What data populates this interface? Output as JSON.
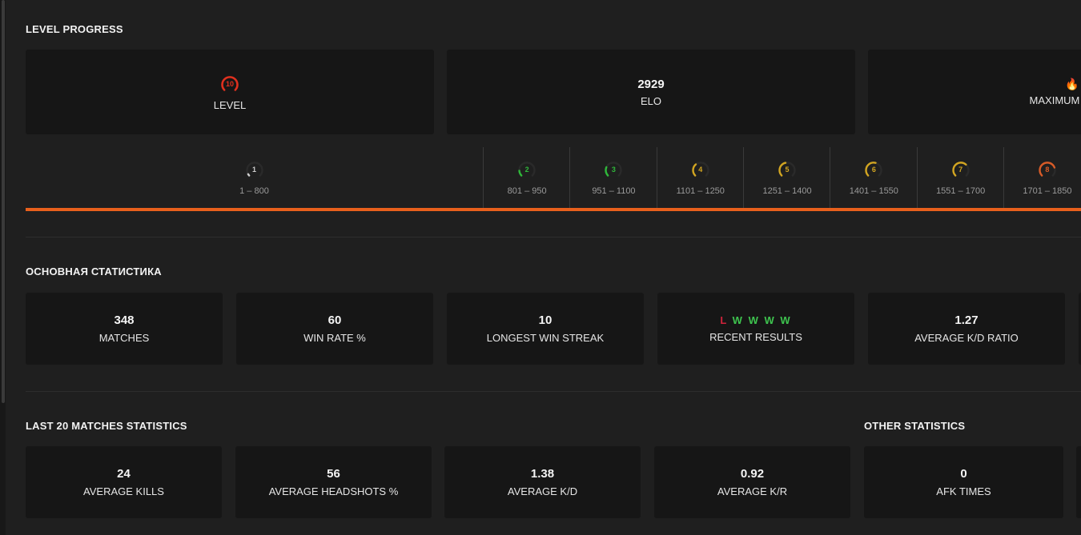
{
  "colors": {
    "accent": "#e8601c",
    "loss": "#d0233b",
    "win": "#3ec44f",
    "level10": "#e0301e"
  },
  "level_progress": {
    "title": "LEVEL PROGRESS",
    "cards": [
      {
        "icon": "level-10-gauge-icon",
        "value": "10",
        "label": "LEVEL"
      },
      {
        "value": "2929",
        "label": "ELO"
      },
      {
        "icon": "fire-icon",
        "value": "🔥",
        "label": "MAXIMUM LEVEL"
      }
    ],
    "progress_fraction": 1.0,
    "ranges": [
      {
        "level": "1",
        "range": "1 – 800",
        "color": "#cfcfcf",
        "fill": 0.05
      },
      {
        "level": "2",
        "range": "801 – 950",
        "color": "#2fb83a",
        "fill": 0.15
      },
      {
        "level": "3",
        "range": "951 – 1100",
        "color": "#2fb83a",
        "fill": 0.25
      },
      {
        "level": "4",
        "range": "1101 – 1250",
        "color": "#d2a521",
        "fill": 0.35
      },
      {
        "level": "5",
        "range": "1251 – 1400",
        "color": "#d2a521",
        "fill": 0.45
      },
      {
        "level": "6",
        "range": "1401 – 1550",
        "color": "#d2a521",
        "fill": 0.55
      },
      {
        "level": "7",
        "range": "1551 – 1700",
        "color": "#d2a521",
        "fill": 0.65
      },
      {
        "level": "8",
        "range": "1701 – 1850",
        "color": "#d85b27",
        "fill": 0.75
      }
    ]
  },
  "main_stats": {
    "title": "ОСНОВНАЯ СТАТИСТИКА",
    "cards": [
      {
        "value": "348",
        "label": "MATCHES"
      },
      {
        "value": "60",
        "label": "WIN RATE %"
      },
      {
        "value": "10",
        "label": "LONGEST WIN STREAK"
      },
      {
        "value": "",
        "label": "RECENT RESULTS"
      },
      {
        "value": "1.27",
        "label": "AVERAGE K/D RATIO"
      }
    ],
    "recent_results": [
      "L",
      "W",
      "W",
      "W",
      "W"
    ]
  },
  "last20": {
    "title": "LAST 20 MATCHES STATISTICS",
    "cards": [
      {
        "value": "24",
        "label": "AVERAGE KILLS"
      },
      {
        "value": "56",
        "label": "AVERAGE HEADSHOTS %"
      },
      {
        "value": "1.38",
        "label": "AVERAGE K/D"
      },
      {
        "value": "0.92",
        "label": "AVERAGE K/R"
      }
    ]
  },
  "other_stats": {
    "title": "OTHER STATISTICS",
    "cards": [
      {
        "value": "0",
        "label": "AFK TIMES"
      }
    ]
  }
}
